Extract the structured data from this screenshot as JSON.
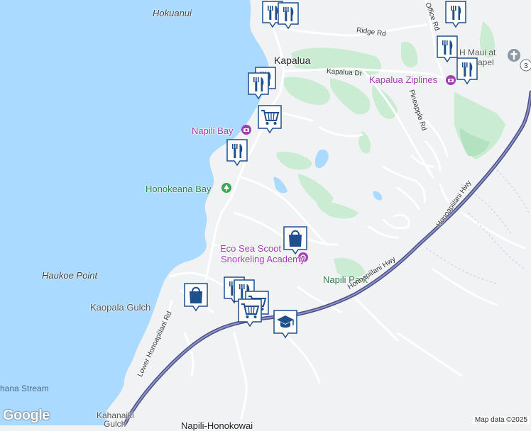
{
  "labels": {
    "hokuanui": "Hokuanui",
    "kapalua": "Kapalua",
    "napili_bay": "Napili Bay",
    "honokeana_bay": "Honokeana Bay",
    "eco_sea_1": "Eco Sea Scoot",
    "eco_sea_2": "Snorkeling Academy",
    "haukoe_point": "Haukoe Point",
    "kaopala_gulch": "Kaopala Gulch",
    "napili_park": "Napili Park",
    "kapalua_ziplines": "Kapalua Ziplines",
    "ridge_rd": "Ridge Rd",
    "kapalua_dr": "Kapalua Dr",
    "pineapple_rd": "Pineapple Rd",
    "office_rd": "Office Rd",
    "honoapiilani_hwy_1": "Honoapiilani Hwy",
    "honoapiilani_hwy_2": "Honoapiilani Hwy",
    "lower_honoapiilani": "Lower Honoapiilani Rd",
    "hana_stream": "hana Stream",
    "kahanaiki_1": "Kahanaiki",
    "kahanaiki_2": "Gulch",
    "h_maui_1": "H   Maui at",
    "h_maui_2": "Ku    apel",
    "bottom_cut": "Napili-Honokowai"
  },
  "footer": {
    "logo": "Google",
    "attribution": "Map data ©2025"
  },
  "colors": {
    "water": "#aadaff",
    "land": "#f1f2f3",
    "golf": "#c9ecd2",
    "highway": "#4a4f88",
    "marker_fill": "#1f4f8c",
    "poi_purple": "#a13fb0",
    "park_green": "#34a853"
  },
  "markers": [
    {
      "name": "restaurant-marker-1",
      "icon": "fork-knife-icon"
    },
    {
      "name": "restaurant-marker-2",
      "icon": "fork-knife-icon"
    },
    {
      "name": "restaurant-marker-3",
      "icon": "fork-knife-icon"
    },
    {
      "name": "restaurant-marker-4",
      "icon": "fork-knife-icon"
    },
    {
      "name": "restaurant-marker-5",
      "icon": "fork-knife-icon"
    },
    {
      "name": "restaurant-marker-6",
      "icon": "fork-knife-icon"
    },
    {
      "name": "restaurant-marker-7",
      "icon": "fork-knife-icon"
    },
    {
      "name": "shopping-cart-marker-1",
      "icon": "shopping-cart-icon"
    },
    {
      "name": "shopping-cart-marker-2",
      "icon": "shopping-cart-icon"
    },
    {
      "name": "shopping-bag-marker-1",
      "icon": "shopping-bag-icon"
    },
    {
      "name": "shopping-bag-marker-2",
      "icon": "shopping-bag-icon"
    },
    {
      "name": "school-marker",
      "icon": "graduation-cap-icon"
    }
  ]
}
